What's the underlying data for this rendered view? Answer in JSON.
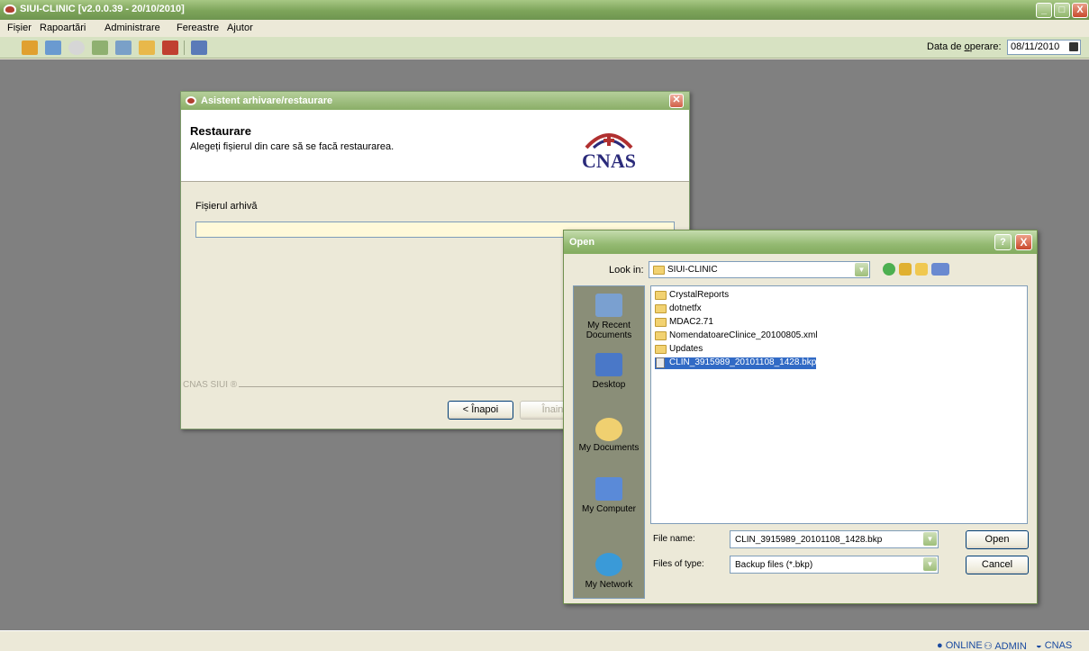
{
  "app": {
    "title": "SIUI-CLINIC [v2.0.0.39 - 20/10/2010]",
    "window_buttons": {
      "minimize": "_",
      "maximize": "□",
      "close": "X"
    }
  },
  "menu": [
    "Fișier",
    "Rapoartări",
    "Administrare",
    "Fereastre",
    "Ajutor"
  ],
  "toolbar": {
    "icons": [
      "users-icon",
      "document-icon",
      "refresh-icon",
      "tool-icon",
      "bottle-icon",
      "person-icon",
      "report-icon",
      "export-icon"
    ],
    "date_label_prefix": "Data de ",
    "date_label_underlined": "o",
    "date_label_suffix": "perare:",
    "date_value": "08/11/2010"
  },
  "status": {
    "online": "ONLINE",
    "user": "ADMIN",
    "org": "CNAS"
  },
  "wizard": {
    "title": "Asistent arhivare/restaurare",
    "heading": "Restaurare",
    "subtitle": "Alegeți fișierul din care să se facă restaurarea.",
    "logo": "CNAS",
    "field_label": "Fișierul arhivă",
    "field_value": "",
    "footer_label": "CNAS SIUI ®",
    "back_button": "< Înapoi",
    "next_button": "Înain"
  },
  "open_dialog": {
    "title": "Open",
    "help": "?",
    "close": "X",
    "look_in_label": "Look in:",
    "look_in_value": "SIUI-CLINIC",
    "places": [
      {
        "label": "My Recent Documents",
        "icon": "recent-documents-icon"
      },
      {
        "label": "Desktop",
        "icon": "desktop-icon"
      },
      {
        "label": "My Documents",
        "icon": "my-documents-icon"
      },
      {
        "label": "My Computer",
        "icon": "my-computer-icon"
      },
      {
        "label": "My Network",
        "icon": "my-network-icon"
      }
    ],
    "files": [
      {
        "name": "CrystalReports",
        "type": "folder"
      },
      {
        "name": "dotnetfx",
        "type": "folder"
      },
      {
        "name": "MDAC2.71",
        "type": "folder"
      },
      {
        "name": "NomendatoareClinice_20100805.xml",
        "type": "folder"
      },
      {
        "name": "Updates",
        "type": "folder"
      },
      {
        "name": "CLIN_3915989_20101108_1428.bkp",
        "type": "file",
        "selected": true
      }
    ],
    "file_name_label": "File name:",
    "file_name_value": "CLIN_3915989_20101108_1428.bkp",
    "file_type_label": "Files of type:",
    "file_type_value": "Backup files (*.bkp)",
    "open_button": "Open",
    "cancel_button": "Cancel"
  },
  "colors": {
    "titlebar": "#8aae67",
    "workspace": "#808080",
    "selection": "#316ac5"
  }
}
